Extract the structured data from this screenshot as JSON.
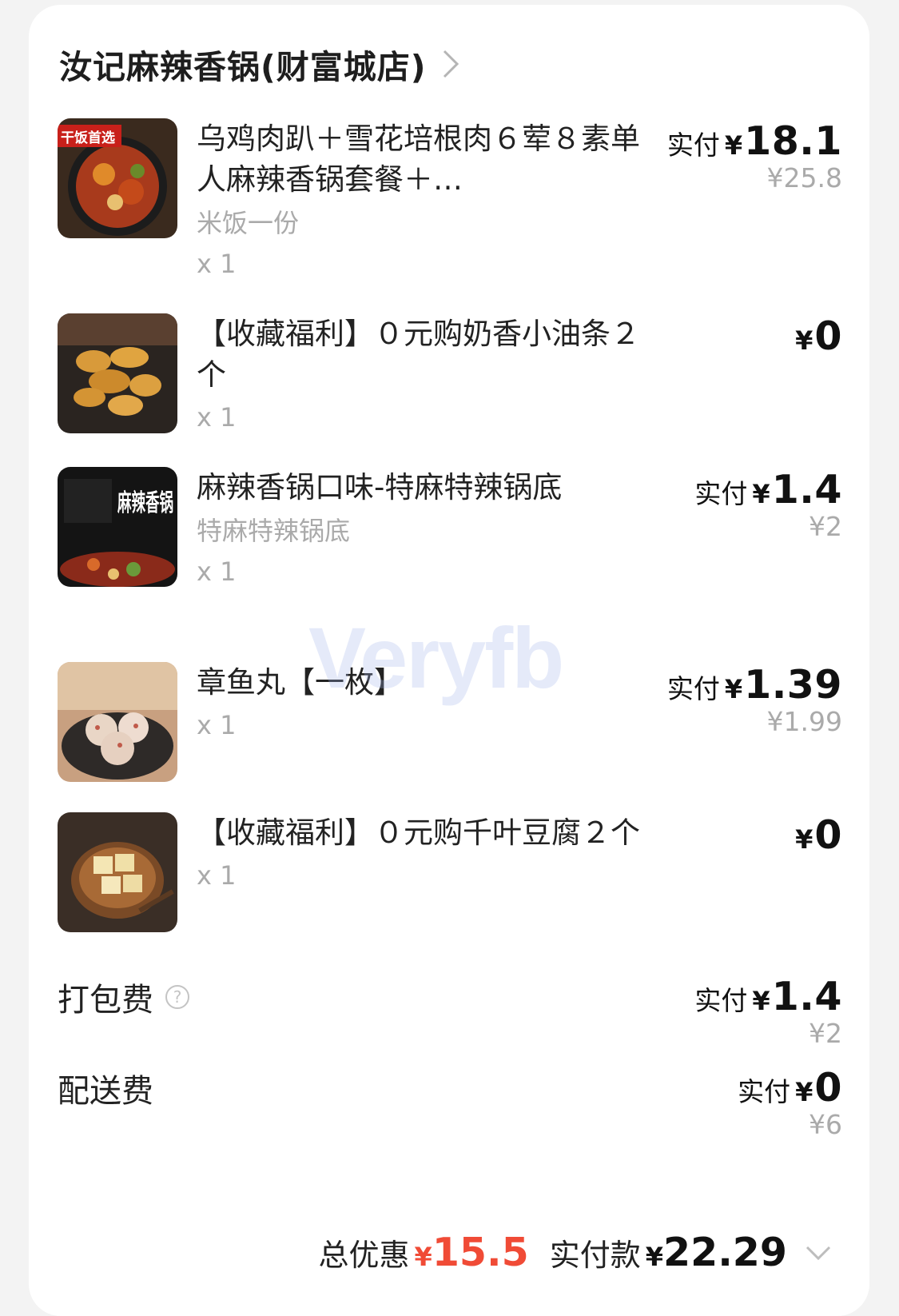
{
  "store": {
    "name": "汝记麻辣香锅(财富城店)",
    "chevron_icon": "chevron-right-icon"
  },
  "items": [
    {
      "name": "乌鸡肉趴＋雪花培根肉６荤８素单人麻辣香锅套餐＋…",
      "spec": "米饭一份",
      "qty": "x 1",
      "paid_label": "实付",
      "currency": "¥",
      "paid": "18.1",
      "original": "¥25.8",
      "thumb_text": "干饭首选"
    },
    {
      "name": "【收藏福利】０元购奶香小油条２个",
      "spec": "",
      "qty": "x 1",
      "paid_label": "",
      "currency": "¥",
      "paid": "0",
      "original": ""
    },
    {
      "name": "麻辣香锅口味-特麻特辣锅底",
      "spec": "特麻特辣锅底",
      "qty": "x 1",
      "paid_label": "实付",
      "currency": "¥",
      "paid": "1.4",
      "original": "¥2",
      "thumb_text": "麻辣香锅"
    },
    {
      "name": "章鱼丸【一枚】",
      "spec": "",
      "qty": "x 1",
      "paid_label": "实付",
      "currency": "¥",
      "paid": "1.39",
      "original": "¥1.99"
    },
    {
      "name": "【收藏福利】０元购千叶豆腐２个",
      "spec": "",
      "qty": "x 1",
      "paid_label": "",
      "currency": "¥",
      "paid": "0",
      "original": ""
    }
  ],
  "fees": [
    {
      "label": "打包费",
      "paid_label": "实付",
      "currency": "¥",
      "paid": "1.4",
      "original": "¥2",
      "help_icon": "help-circle-icon"
    },
    {
      "label": "配送费",
      "paid_label": "实付",
      "currency": "¥",
      "paid": "0",
      "original": "¥6"
    }
  ],
  "summary": {
    "discount_label": "总优惠",
    "discount_currency": "¥",
    "discount": "15.5",
    "total_label": "实付款",
    "total_currency": "¥",
    "total": "22.29",
    "expand_icon": "chevron-down-icon"
  },
  "watermark": "Veryfb",
  "colors": {
    "accent_red": "#f04b36",
    "muted_gray": "#aaaaaa",
    "text_dark": "#222222"
  }
}
